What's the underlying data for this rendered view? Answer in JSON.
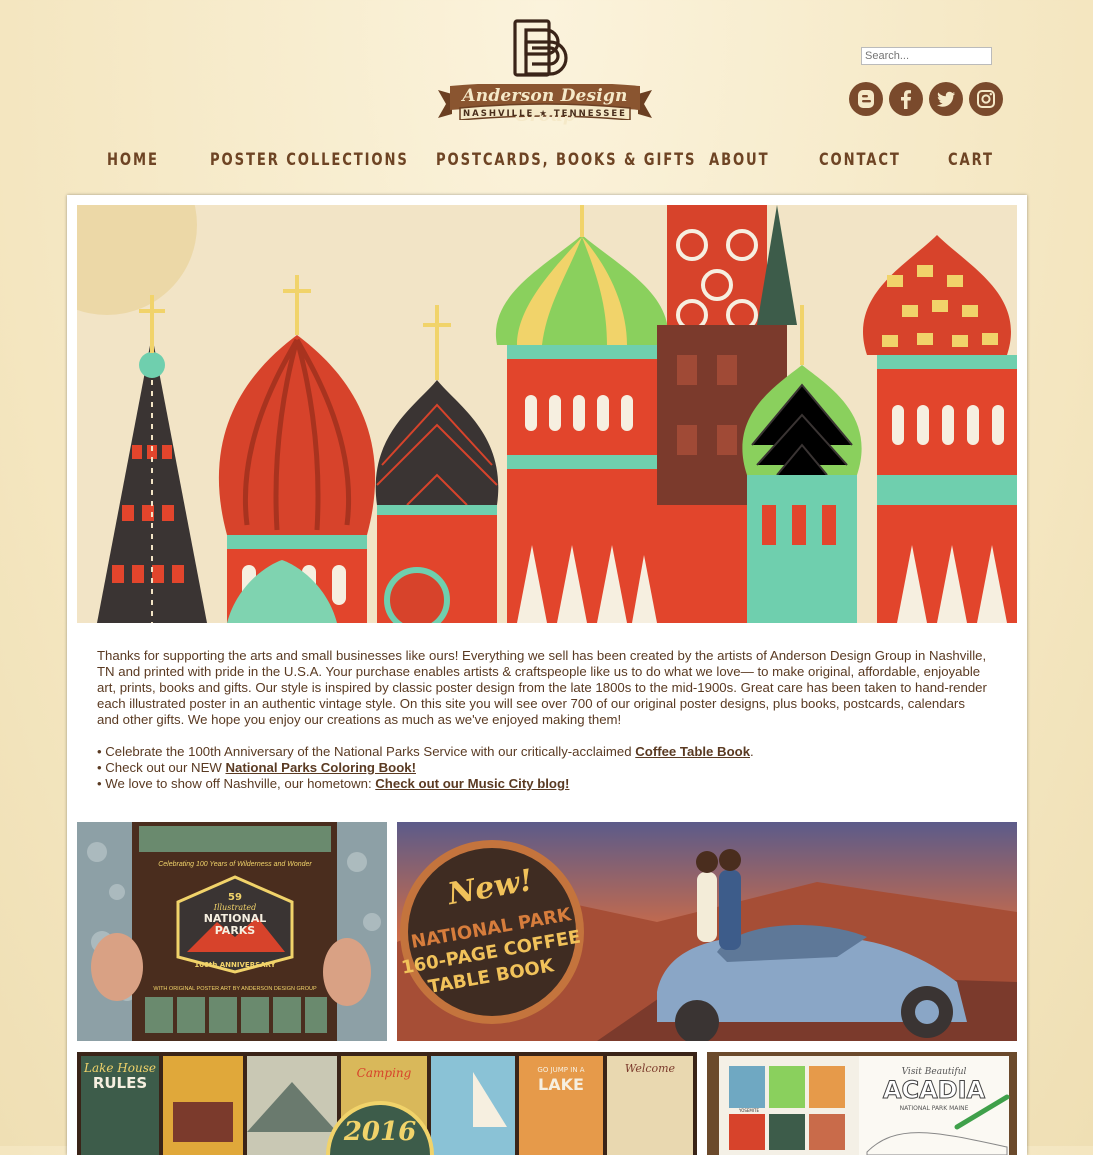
{
  "header": {
    "logo_script": "Anderson Design Group",
    "logo_sub": "NASHVILLE ★ TENNESSEE",
    "search_placeholder": "Search..."
  },
  "social": [
    {
      "name": "blogger-icon"
    },
    {
      "name": "facebook-icon"
    },
    {
      "name": "twitter-icon"
    },
    {
      "name": "instagram-icon"
    }
  ],
  "nav": {
    "items": [
      {
        "label": "HOME"
      },
      {
        "label": "POSTER COLLECTIONS"
      },
      {
        "label": "POSTCARDS, BOOKS & GIFTS"
      },
      {
        "label": "ABOUT"
      },
      {
        "label": "CONTACT"
      },
      {
        "label": "CART"
      }
    ]
  },
  "intro": {
    "paragraph": "Thanks for supporting the arts and small businesses like ours! Everything we sell has been created by the artists of Anderson Design Group in Nashville, TN and printed with pride in the U.S.A. Your purchase enables artists & craftspeople like us to do what we love— to make original, affordable, enjoyable art, prints, books and gifts. Our style is inspired by classic poster design from the late 1800s to the mid-1900s. Great care has been taken to hand-render each illustrated poster in an authentic vintage style. On this site you will see over 700 of our original poster designs, plus books, postcards, calendars and other gifts. We hope you enjoy our creations as much as we've enjoyed making them!",
    "bullet1_text": "• Celebrate the 100th Anniversary of the National Parks Service with our critically-acclaimed ",
    "bullet1_link": "Coffee Table Book",
    "bullet1_after": ".",
    "bullet2_text": "• Check out our NEW ",
    "bullet2_link": "National Parks Coloring Book! ",
    "bullet3_text": "• We love to show off Nashville, our hometown: ",
    "bullet3_link": "Check out our Music City blog!"
  },
  "promos": {
    "book_top": "Celebrating 100 Years of Wilderness and Wonder",
    "book_number": "59",
    "book_title_1": "Illustrated",
    "book_title_2": "NATIONAL",
    "book_title_3": "PARKS",
    "book_anniv": "100th ANNIVERSARY",
    "book_bottom": "WITH ORIGINAL POSTER ART BY ANDERSON DESIGN GROUP",
    "badge_new": "New!",
    "badge_line1": "NATIONAL PARK",
    "badge_line2": "160-PAGE COFFEE",
    "badge_line3": "TABLE BOOK",
    "calendar_rules_1": "Lake House",
    "calendar_rules_2": "RULES",
    "calendar_camping": "Camping",
    "calendar_lake": "LAKE",
    "calendar_golake": "GO JUMP IN A",
    "calendar_welcome": "Welcome",
    "calendar_year": "2016",
    "coloring_visit": "Visit Beautiful",
    "coloring_title": "ACADIA",
    "coloring_sub": "NATIONAL PARK MAINE",
    "coloring_yosemite": "YOSEMITE"
  }
}
